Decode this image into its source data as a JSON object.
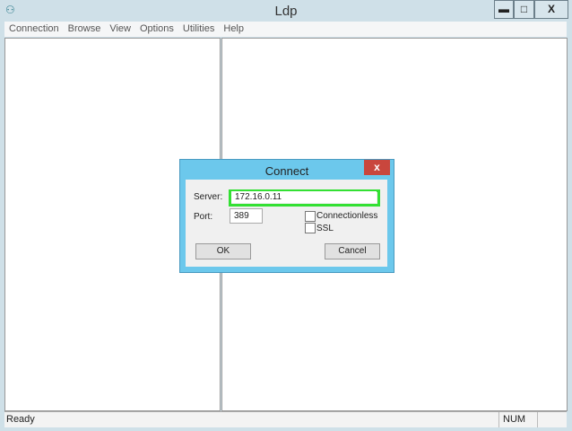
{
  "window": {
    "title": "Ldp",
    "minimize": "▬",
    "maximize": "□",
    "close": "X"
  },
  "menu": [
    "Connection",
    "Browse",
    "View",
    "Options",
    "Utilities",
    "Help"
  ],
  "status": {
    "text": "Ready",
    "num": "NUM"
  },
  "dialog": {
    "title": "Connect",
    "close": "x",
    "server_label": "Server:",
    "server_value": "172.16.0.11",
    "port_label": "Port:",
    "port_value": "389",
    "connectionless": "Connectionless",
    "ssl": "SSL",
    "ok": "OK",
    "cancel": "Cancel",
    "highlight_color": "#33e033"
  }
}
